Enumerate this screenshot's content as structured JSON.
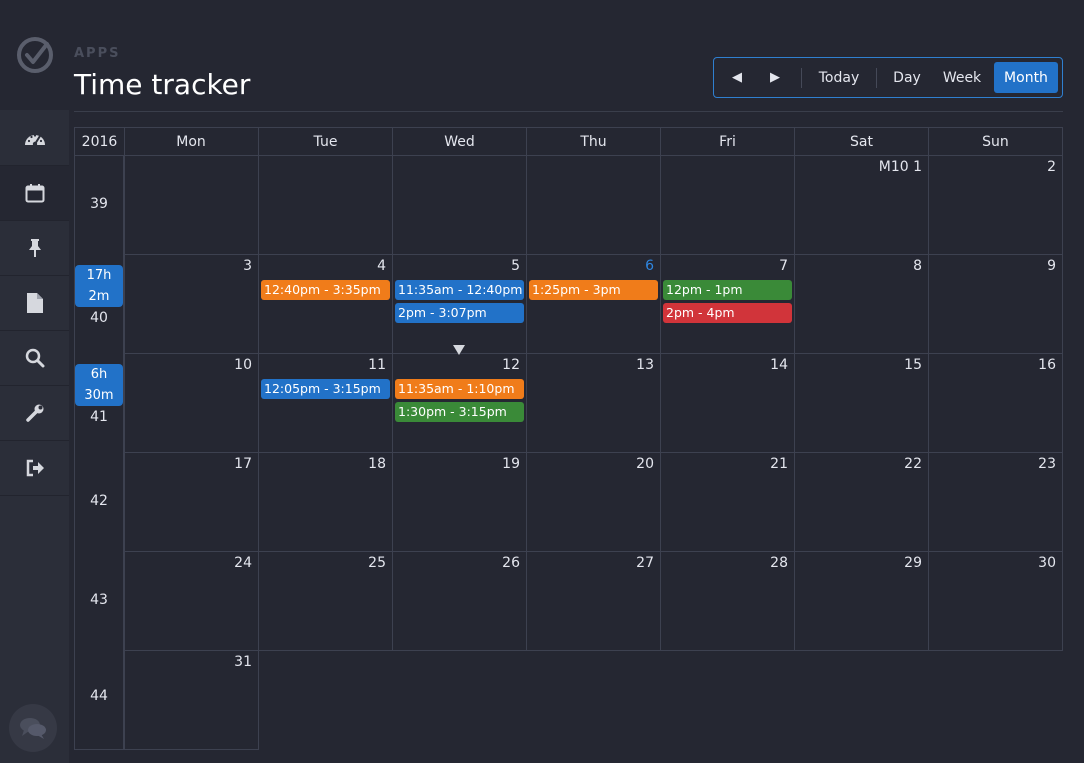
{
  "header": {
    "apps_label": "APPS",
    "title": "Time tracker"
  },
  "sidebar": {
    "items": [
      {
        "name": "dashboard-icon"
      },
      {
        "name": "calendar-icon"
      },
      {
        "name": "pin-icon"
      },
      {
        "name": "file-icon"
      },
      {
        "name": "search-icon"
      },
      {
        "name": "wrench-icon"
      },
      {
        "name": "logout-icon"
      }
    ],
    "chat_icon": "chat-icon"
  },
  "toolbar": {
    "prev": "◀",
    "next": "▶",
    "today": "Today",
    "day": "Day",
    "week": "Week",
    "month": "Month",
    "active": "Month"
  },
  "calendar": {
    "year": "2016",
    "weekdays": [
      "Mon",
      "Tue",
      "Wed",
      "Thu",
      "Fri",
      "Sat",
      "Sun"
    ],
    "weeks": [
      {
        "number": "39",
        "total": null,
        "days": [
          "",
          "",
          "",
          "",
          "",
          "M10 1",
          "2"
        ]
      },
      {
        "number": "40",
        "total": [
          "17h",
          "2m"
        ],
        "days": [
          "3",
          "4",
          "5",
          "6",
          "7",
          "8",
          "9"
        ]
      },
      {
        "number": "41",
        "total": [
          "6h",
          "30m"
        ],
        "days": [
          "10",
          "11",
          "12",
          "13",
          "14",
          "15",
          "16"
        ]
      },
      {
        "number": "42",
        "total": null,
        "days": [
          "17",
          "18",
          "19",
          "20",
          "21",
          "22",
          "23"
        ]
      },
      {
        "number": "43",
        "total": null,
        "days": [
          "24",
          "25",
          "26",
          "27",
          "28",
          "29",
          "30"
        ]
      },
      {
        "number": "44",
        "total": null,
        "days": [
          "31"
        ]
      }
    ],
    "highlight_day": "6",
    "events": [
      {
        "week": 1,
        "day": 1,
        "slot": 0,
        "label": "12:40pm - 3:35pm",
        "color": "orange"
      },
      {
        "week": 1,
        "day": 2,
        "slot": 0,
        "label": "11:35am - 12:40pm",
        "color": "blue"
      },
      {
        "week": 1,
        "day": 2,
        "slot": 1,
        "label": "2pm - 3:07pm",
        "color": "blue"
      },
      {
        "week": 1,
        "day": 3,
        "slot": 0,
        "label": "1:25pm - 3pm",
        "color": "orange"
      },
      {
        "week": 1,
        "day": 4,
        "slot": 0,
        "label": "12pm - 1pm",
        "color": "green"
      },
      {
        "week": 1,
        "day": 4,
        "slot": 1,
        "label": "2pm - 4pm",
        "color": "red"
      },
      {
        "week": 2,
        "day": 1,
        "slot": 0,
        "label": "12:05pm - 3:15pm",
        "color": "blue"
      },
      {
        "week": 2,
        "day": 2,
        "slot": 0,
        "label": "11:35am - 1:10pm",
        "color": "orange"
      },
      {
        "week": 2,
        "day": 2,
        "slot": 1,
        "label": "1:30pm - 3:15pm",
        "color": "green"
      }
    ]
  },
  "colors": {
    "background": "#252732",
    "sidebar": "#2b2e39",
    "accent": "#2272c8",
    "orange": "#f07c1a",
    "blue": "#2272c8",
    "green": "#3a8a38",
    "red": "#d1343a"
  }
}
